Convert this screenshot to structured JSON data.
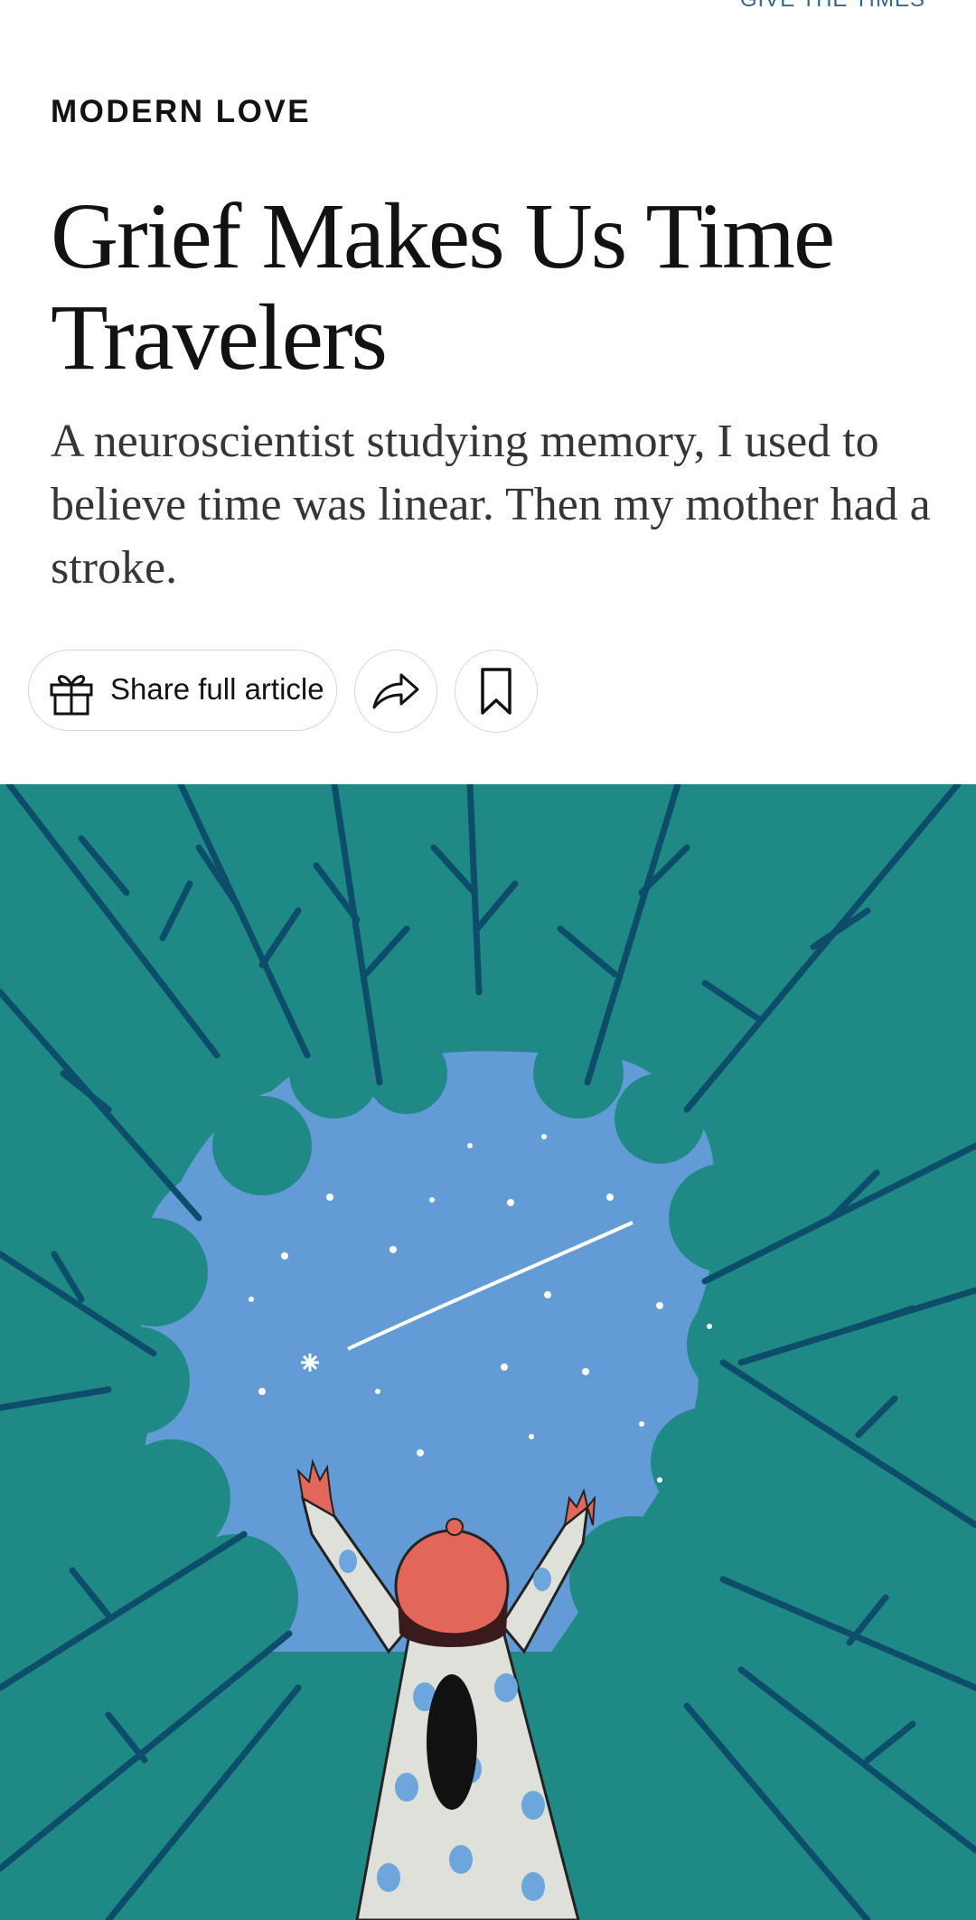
{
  "header": {
    "link_text": "GIVE THE TIMES"
  },
  "article": {
    "kicker": "MODERN LOVE",
    "headline": "Grief Makes Us Time Travelers",
    "summary": "A neuroscientist studying memory, I used to believe time was linear. Then my mother had a stroke."
  },
  "toolbar": {
    "share_full_label": "Share full article",
    "icons": {
      "gift": "gift-icon",
      "share": "share-arrow-icon",
      "save": "bookmark-icon"
    }
  },
  "hero": {
    "icon": "illustration",
    "colors": {
      "trees": "#1f8a85",
      "branches": "#0e4c6b",
      "sky": "#629bd6",
      "hat": "#e2665a",
      "dress": "#dfe0da",
      "dots": "#6da6dc"
    }
  }
}
